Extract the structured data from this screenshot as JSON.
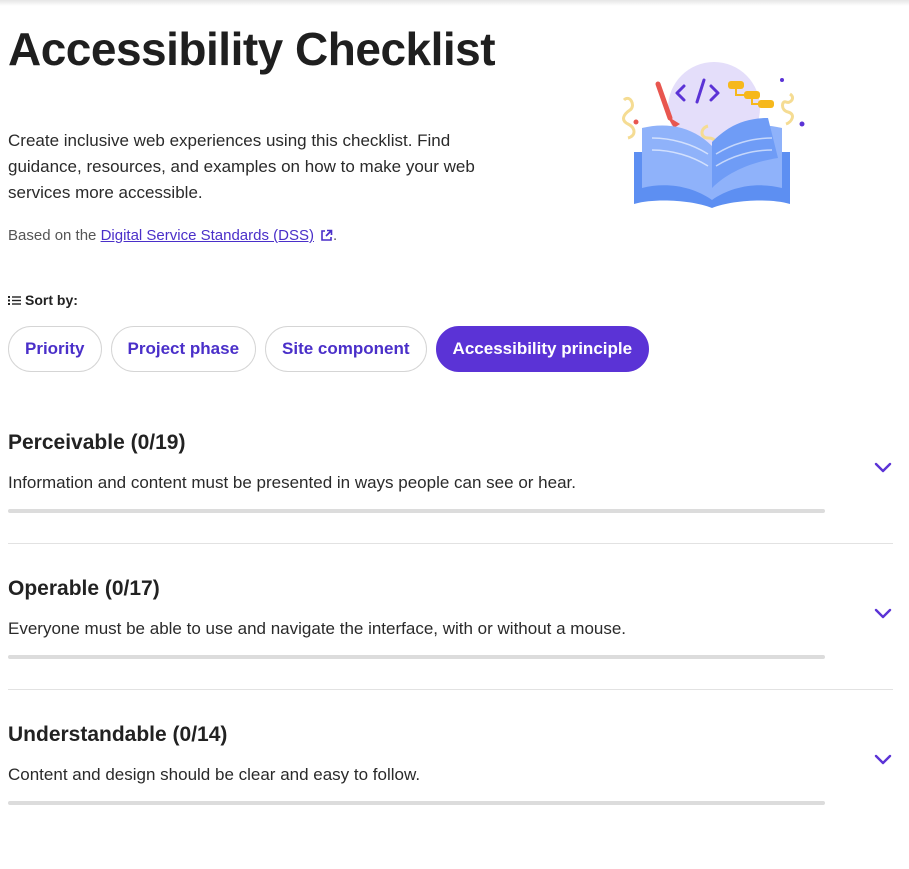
{
  "page": {
    "title": "Accessibility Checklist",
    "intro": "Create inclusive web experiences using this checklist. Find guidance, resources, and examples on how to make your web services more accessible.",
    "based_prefix": "Based on the ",
    "based_link": "Digital Service Standards (DSS)",
    "based_suffix": "."
  },
  "sort": {
    "label": "Sort by:",
    "options": [
      {
        "label": "Priority",
        "active": false
      },
      {
        "label": "Project phase",
        "active": false
      },
      {
        "label": "Site component",
        "active": false
      },
      {
        "label": "Accessibility principle",
        "active": true
      }
    ]
  },
  "sections": [
    {
      "title": "Perceivable (0/19)",
      "description": "Information and content must be presented in ways people can see or hear.",
      "progress": 0
    },
    {
      "title": "Operable (0/17)",
      "description": "Everyone must be able to use and navigate the interface, with or without a mouse.",
      "progress": 0
    },
    {
      "title": "Understandable (0/14)",
      "description": "Content and design should be clear and easy to follow.",
      "progress": 0
    }
  ],
  "colors": {
    "accent": "#5b33d6",
    "link": "#4a2fc9",
    "progress_track": "#dcdcdc"
  },
  "icons": {
    "sort": "list-icon",
    "external_link": "external-link-icon",
    "expand": "chevron-down-icon",
    "hero": "open-book-illustration"
  }
}
